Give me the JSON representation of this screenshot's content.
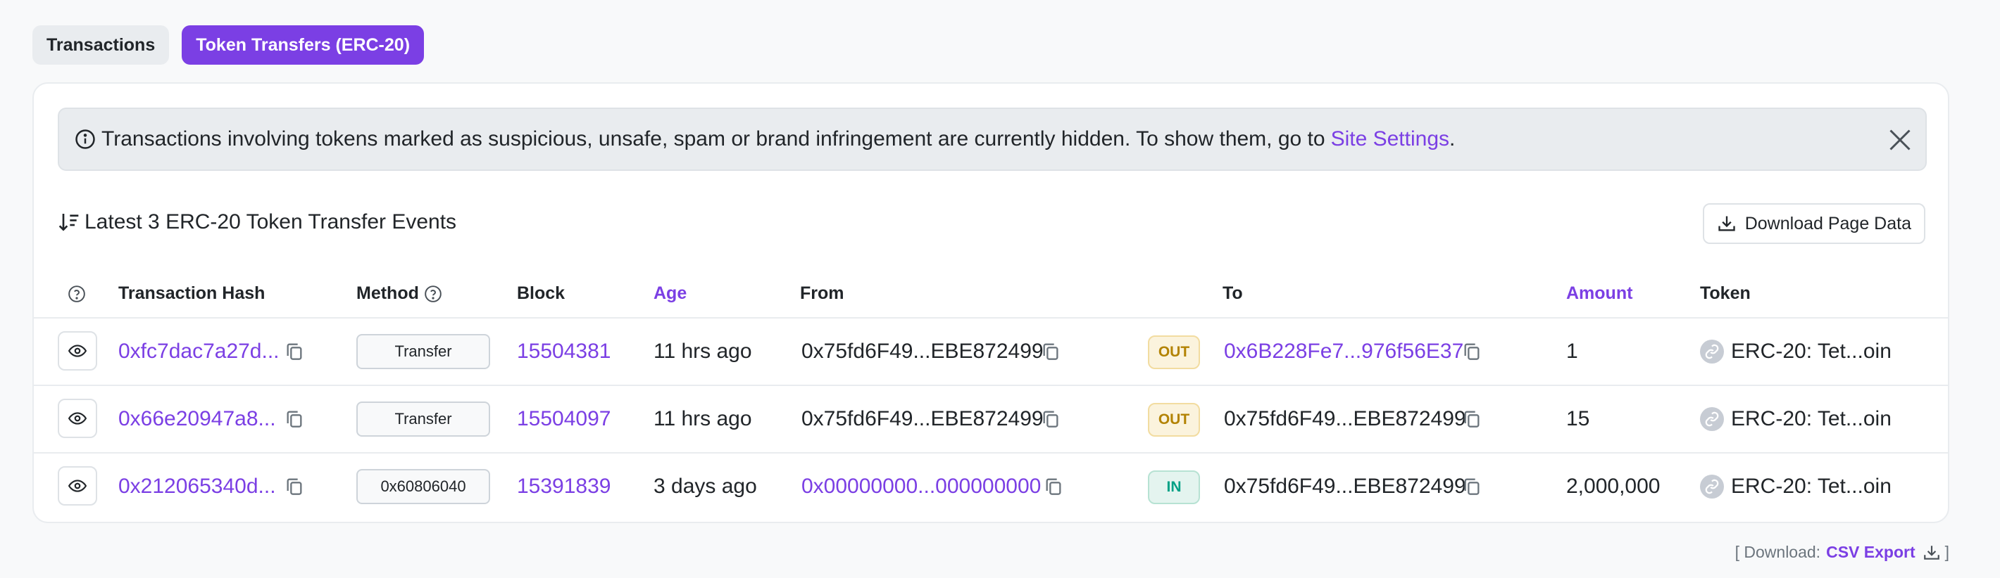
{
  "tabs": [
    {
      "label": "Transactions",
      "active": false
    },
    {
      "label": "Token Transfers (ERC-20)",
      "active": true
    }
  ],
  "notice": {
    "text": "Transactions involving tokens marked as suspicious, unsafe, spam or brand infringement are currently hidden. To show them, go to",
    "link": "Site Settings",
    "suffix": "."
  },
  "heading": "Latest 3 ERC-20 Token Transfer Events",
  "download_button": "Download Page Data",
  "columns": {
    "hash": "Transaction Hash",
    "method": "Method",
    "block": "Block",
    "age": "Age",
    "from": "From",
    "to": "To",
    "amount": "Amount",
    "token": "Token"
  },
  "rows": [
    {
      "hash": "0xfc7dac7a27d...",
      "method": "Transfer",
      "block": "15504381",
      "age": "11 hrs ago",
      "from": "0x75fd6F49...EBE872499",
      "from_link": false,
      "direction": "OUT",
      "to": "0x6B228Fe7...976f56E37",
      "to_link": true,
      "amount": "1",
      "token": "ERC-20: Tet...oin"
    },
    {
      "hash": "0x66e20947a8...",
      "method": "Transfer",
      "block": "15504097",
      "age": "11 hrs ago",
      "from": "0x75fd6F49...EBE872499",
      "from_link": false,
      "direction": "OUT",
      "to": "0x75fd6F49...EBE872499",
      "to_link": false,
      "amount": "15",
      "token": "ERC-20: Tet...oin"
    },
    {
      "hash": "0x212065340d...",
      "method": "0x60806040",
      "block": "15391839",
      "age": "3 days ago",
      "from": "0x00000000...000000000",
      "from_link": true,
      "direction": "IN",
      "to": "0x75fd6F49...EBE872499",
      "to_link": false,
      "amount": "2,000,000",
      "token": "ERC-20: Tet...oin"
    }
  ],
  "footer": {
    "prefix": "[ Download:",
    "link": "CSV Export",
    "suffix": "]"
  },
  "colors": {
    "accent": "#7b3fe4",
    "out_badge": "#b38304",
    "in_badge": "#00a186"
  }
}
